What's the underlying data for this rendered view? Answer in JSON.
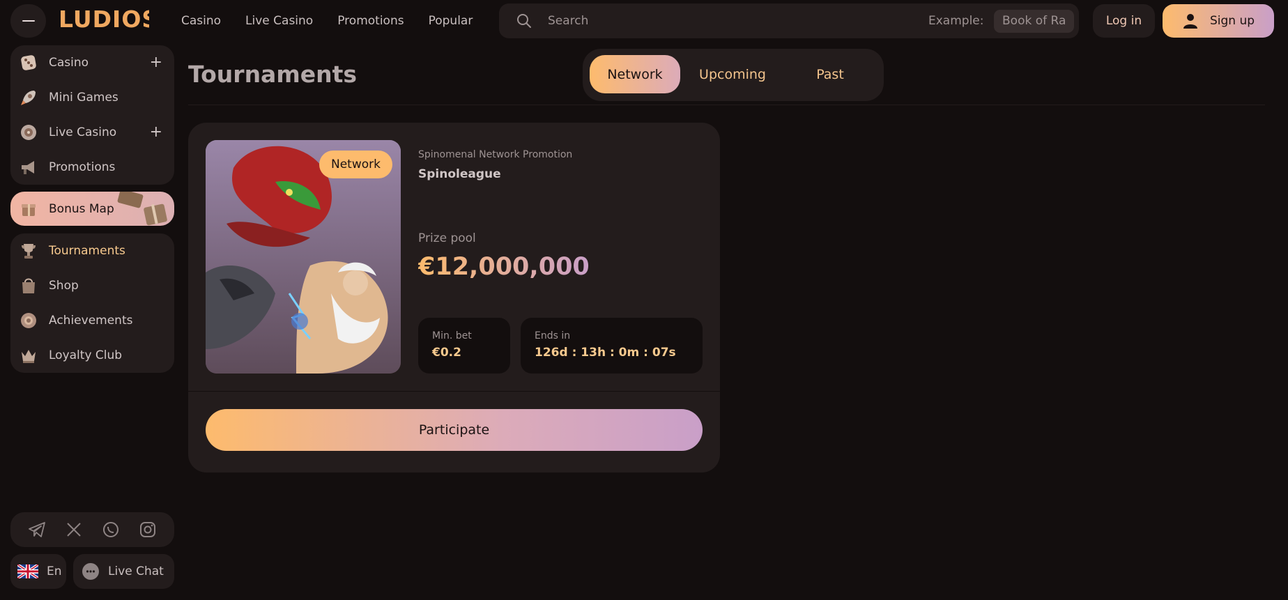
{
  "header": {
    "logo": "LUDIOS",
    "nav": [
      "Casino",
      "Live Casino",
      "Promotions",
      "Popular"
    ],
    "search": {
      "placeholder": "Search",
      "example_label": "Example:",
      "example_value": "Book of Ra"
    },
    "login_label": "Log in",
    "signup_label": "Sign up"
  },
  "sidebar": {
    "group1": [
      {
        "label": "Casino",
        "icon": "dice-icon",
        "expandable": true
      },
      {
        "label": "Mini Games",
        "icon": "rocket-icon",
        "expandable": false
      },
      {
        "label": "Live Casino",
        "icon": "roulette-icon",
        "expandable": true
      },
      {
        "label": "Promotions",
        "icon": "megaphone-icon",
        "expandable": false
      }
    ],
    "bonus_map": {
      "label": "Bonus Map",
      "icon": "gift-icon"
    },
    "group2": [
      {
        "label": "Tournaments",
        "icon": "trophy-icon",
        "active": true
      },
      {
        "label": "Shop",
        "icon": "shopping-bag-icon"
      },
      {
        "label": "Achievements",
        "icon": "badge-icon"
      },
      {
        "label": "Loyalty Club",
        "icon": "crown-icon"
      }
    ],
    "social": [
      "telegram-icon",
      "x-icon",
      "whatsapp-icon",
      "instagram-icon"
    ],
    "language": "En",
    "live_chat": "Live Chat"
  },
  "main": {
    "title": "Tournaments",
    "tabs": [
      {
        "label": "Network",
        "active": true
      },
      {
        "label": "Upcoming",
        "active": false
      },
      {
        "label": "Past",
        "active": false
      }
    ],
    "tournament": {
      "badge": "Network",
      "provider": "Spinomenal Network Promotion",
      "name": "Spinoleague",
      "prize_pool_label": "Prize pool",
      "prize_pool_value": "€12,000,000",
      "min_bet_label": "Min. bet",
      "min_bet_value": "€0.2",
      "ends_in_label": "Ends in",
      "ends_in_value": "126d : 13h : 0m : 07s",
      "cta": "Participate"
    }
  },
  "colors": {
    "background": "#130e0e",
    "panel": "#231c1c",
    "accent_orange": "#fdbb6d",
    "accent_purple": "#c99fc8",
    "muted_text": "#9e9393"
  }
}
